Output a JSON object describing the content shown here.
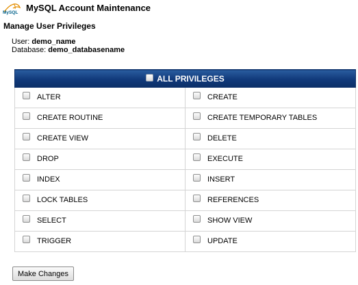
{
  "app": {
    "title": "MySQL Account Maintenance",
    "logo_text": "MySQL"
  },
  "section_title": "Manage User Privileges",
  "account": {
    "user_label": "User:",
    "user_value": "demo_name",
    "database_label": "Database:",
    "database_value": "demo_databasename"
  },
  "privileges": {
    "all_label": "ALL PRIVILEGES",
    "all_checked": false,
    "items": [
      {
        "label": "ALTER",
        "checked": false
      },
      {
        "label": "CREATE",
        "checked": false
      },
      {
        "label": "CREATE ROUTINE",
        "checked": false
      },
      {
        "label": "CREATE TEMPORARY TABLES",
        "checked": false
      },
      {
        "label": "CREATE VIEW",
        "checked": false
      },
      {
        "label": "DELETE",
        "checked": false
      },
      {
        "label": "DROP",
        "checked": false
      },
      {
        "label": "EXECUTE",
        "checked": false
      },
      {
        "label": "INDEX",
        "checked": false
      },
      {
        "label": "INSERT",
        "checked": false
      },
      {
        "label": "LOCK TABLES",
        "checked": false
      },
      {
        "label": "REFERENCES",
        "checked": false
      },
      {
        "label": "SELECT",
        "checked": false
      },
      {
        "label": "SHOW VIEW",
        "checked": false
      },
      {
        "label": "TRIGGER",
        "checked": false
      },
      {
        "label": "UPDATE",
        "checked": false
      }
    ]
  },
  "buttons": {
    "submit_label": "Make Changes"
  },
  "colors": {
    "header_bg": "#10397a",
    "border": "#d4d4d4"
  }
}
